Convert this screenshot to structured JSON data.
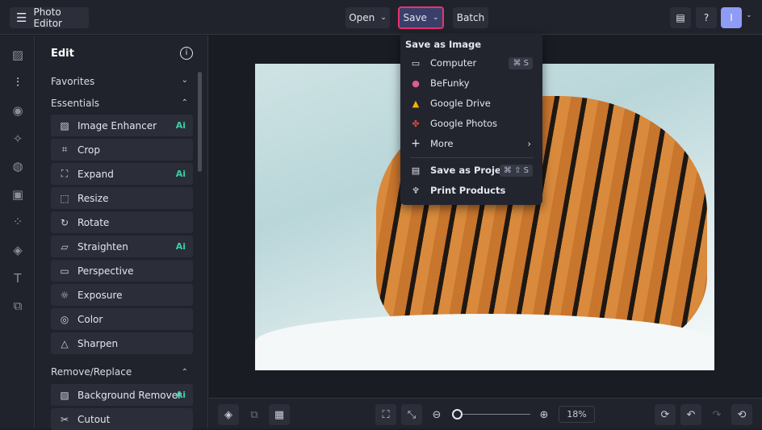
{
  "header": {
    "app_title": "Photo Editor",
    "open_label": "Open",
    "save_label": "Save",
    "batch_label": "Batch",
    "avatar_initial": "I",
    "save_highlight_color": "#e8336d"
  },
  "panel": {
    "title": "Edit",
    "favorites": "Favorites",
    "essentials": "Essentials",
    "remove_replace": "Remove/Replace",
    "items": [
      {
        "label": "Image Enhancer",
        "ai": "Ai"
      },
      {
        "label": "Crop"
      },
      {
        "label": "Expand",
        "ai": "Ai"
      },
      {
        "label": "Resize"
      },
      {
        "label": "Rotate"
      },
      {
        "label": "Straighten",
        "ai": "Ai"
      },
      {
        "label": "Perspective"
      },
      {
        "label": "Exposure"
      },
      {
        "label": "Color"
      },
      {
        "label": "Sharpen"
      }
    ],
    "remove_items": [
      {
        "label": "Background Remover",
        "ai": "Ai"
      },
      {
        "label": "Cutout"
      }
    ]
  },
  "menu": {
    "heading": "Save as Image",
    "computer": "Computer",
    "computer_shortcut": "⌘ S",
    "befunky": "BeFunky",
    "gdrive": "Google Drive",
    "gphotos": "Google Photos",
    "more": "More",
    "project": "Save as Project",
    "project_shortcut": "⌘ ⇧ S",
    "print": "Print Products"
  },
  "bottom": {
    "zoom": "18%",
    "zoom_fraction": 0.05
  }
}
